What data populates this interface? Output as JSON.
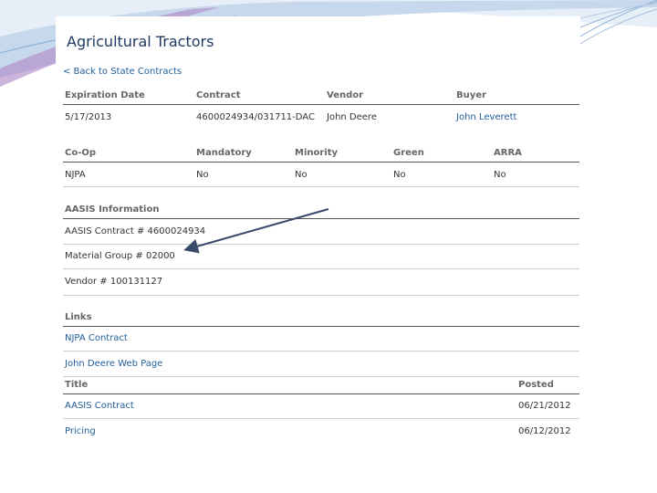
{
  "page": {
    "title": "Agricultural Tractors",
    "back_link": "< Back to State Contracts"
  },
  "contract_table": {
    "headers": [
      "Expiration Date",
      "Contract",
      "Vendor",
      "Buyer"
    ],
    "values": [
      "5/17/2013",
      "4600024934/031711-DAC",
      "John Deere",
      "John Leverett"
    ]
  },
  "flags_table": {
    "headers": [
      "Co-Op",
      "Mandatory",
      "Minority",
      "Green",
      "ARRA"
    ],
    "values": [
      "NJPA",
      "No",
      "No",
      "No",
      "No"
    ]
  },
  "aasis": {
    "heading": "AASIS Information",
    "items": [
      "AASIS Contract # 4600024934",
      "Material Group # 02000",
      "Vendor # 100131127"
    ]
  },
  "links": {
    "heading": "Links",
    "items": [
      "NJPA Contract",
      "John Deere Web Page"
    ]
  },
  "documents": {
    "headers": [
      "Title",
      "Posted"
    ],
    "rows": [
      {
        "title": "AASIS Contract",
        "posted": "06/21/2012"
      },
      {
        "title": "Pricing",
        "posted": "06/12/2012"
      }
    ]
  },
  "colors": {
    "link": "#1f5d99",
    "title": "#1f3b63",
    "header_text": "#666666",
    "rule": "#555555",
    "decor_blue": "#8fb2d6",
    "decor_purple": "#b08cc8"
  }
}
